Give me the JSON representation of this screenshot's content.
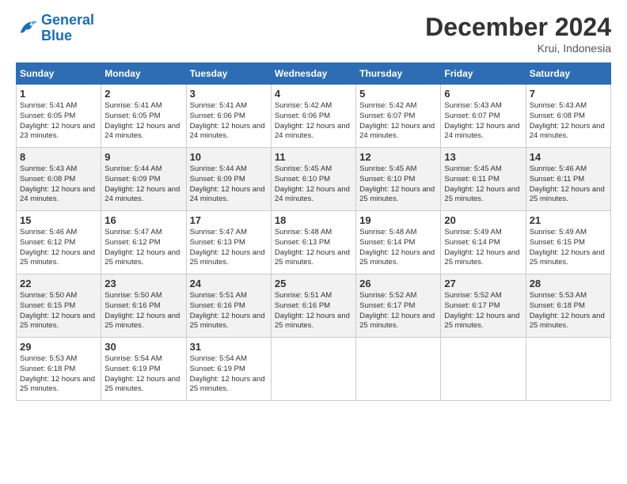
{
  "logo": {
    "line1": "General",
    "line2": "Blue"
  },
  "title": "December 2024",
  "location": "Krui, Indonesia",
  "weekdays": [
    "Sunday",
    "Monday",
    "Tuesday",
    "Wednesday",
    "Thursday",
    "Friday",
    "Saturday"
  ],
  "weeks": [
    [
      {
        "day": "1",
        "sr": "5:41 AM",
        "ss": "6:05 PM",
        "dl": "12 hours and 23 minutes."
      },
      {
        "day": "2",
        "sr": "5:41 AM",
        "ss": "6:05 PM",
        "dl": "12 hours and 24 minutes."
      },
      {
        "day": "3",
        "sr": "5:41 AM",
        "ss": "6:06 PM",
        "dl": "12 hours and 24 minutes."
      },
      {
        "day": "4",
        "sr": "5:42 AM",
        "ss": "6:06 PM",
        "dl": "12 hours and 24 minutes."
      },
      {
        "day": "5",
        "sr": "5:42 AM",
        "ss": "6:07 PM",
        "dl": "12 hours and 24 minutes."
      },
      {
        "day": "6",
        "sr": "5:43 AM",
        "ss": "6:07 PM",
        "dl": "12 hours and 24 minutes."
      },
      {
        "day": "7",
        "sr": "5:43 AM",
        "ss": "6:08 PM",
        "dl": "12 hours and 24 minutes."
      }
    ],
    [
      {
        "day": "8",
        "sr": "5:43 AM",
        "ss": "6:08 PM",
        "dl": "12 hours and 24 minutes."
      },
      {
        "day": "9",
        "sr": "5:44 AM",
        "ss": "6:09 PM",
        "dl": "12 hours and 24 minutes."
      },
      {
        "day": "10",
        "sr": "5:44 AM",
        "ss": "6:09 PM",
        "dl": "12 hours and 24 minutes."
      },
      {
        "day": "11",
        "sr": "5:45 AM",
        "ss": "6:10 PM",
        "dl": "12 hours and 24 minutes."
      },
      {
        "day": "12",
        "sr": "5:45 AM",
        "ss": "6:10 PM",
        "dl": "12 hours and 25 minutes."
      },
      {
        "day": "13",
        "sr": "5:45 AM",
        "ss": "6:11 PM",
        "dl": "12 hours and 25 minutes."
      },
      {
        "day": "14",
        "sr": "5:46 AM",
        "ss": "6:11 PM",
        "dl": "12 hours and 25 minutes."
      }
    ],
    [
      {
        "day": "15",
        "sr": "5:46 AM",
        "ss": "6:12 PM",
        "dl": "12 hours and 25 minutes."
      },
      {
        "day": "16",
        "sr": "5:47 AM",
        "ss": "6:12 PM",
        "dl": "12 hours and 25 minutes."
      },
      {
        "day": "17",
        "sr": "5:47 AM",
        "ss": "6:13 PM",
        "dl": "12 hours and 25 minutes."
      },
      {
        "day": "18",
        "sr": "5:48 AM",
        "ss": "6:13 PM",
        "dl": "12 hours and 25 minutes."
      },
      {
        "day": "19",
        "sr": "5:48 AM",
        "ss": "6:14 PM",
        "dl": "12 hours and 25 minutes."
      },
      {
        "day": "20",
        "sr": "5:49 AM",
        "ss": "6:14 PM",
        "dl": "12 hours and 25 minutes."
      },
      {
        "day": "21",
        "sr": "5:49 AM",
        "ss": "6:15 PM",
        "dl": "12 hours and 25 minutes."
      }
    ],
    [
      {
        "day": "22",
        "sr": "5:50 AM",
        "ss": "6:15 PM",
        "dl": "12 hours and 25 minutes."
      },
      {
        "day": "23",
        "sr": "5:50 AM",
        "ss": "6:16 PM",
        "dl": "12 hours and 25 minutes."
      },
      {
        "day": "24",
        "sr": "5:51 AM",
        "ss": "6:16 PM",
        "dl": "12 hours and 25 minutes."
      },
      {
        "day": "25",
        "sr": "5:51 AM",
        "ss": "6:16 PM",
        "dl": "12 hours and 25 minutes."
      },
      {
        "day": "26",
        "sr": "5:52 AM",
        "ss": "6:17 PM",
        "dl": "12 hours and 25 minutes."
      },
      {
        "day": "27",
        "sr": "5:52 AM",
        "ss": "6:17 PM",
        "dl": "12 hours and 25 minutes."
      },
      {
        "day": "28",
        "sr": "5:53 AM",
        "ss": "6:18 PM",
        "dl": "12 hours and 25 minutes."
      }
    ],
    [
      {
        "day": "29",
        "sr": "5:53 AM",
        "ss": "6:18 PM",
        "dl": "12 hours and 25 minutes."
      },
      {
        "day": "30",
        "sr": "5:54 AM",
        "ss": "6:19 PM",
        "dl": "12 hours and 25 minutes."
      },
      {
        "day": "31",
        "sr": "5:54 AM",
        "ss": "6:19 PM",
        "dl": "12 hours and 25 minutes."
      },
      null,
      null,
      null,
      null
    ]
  ]
}
